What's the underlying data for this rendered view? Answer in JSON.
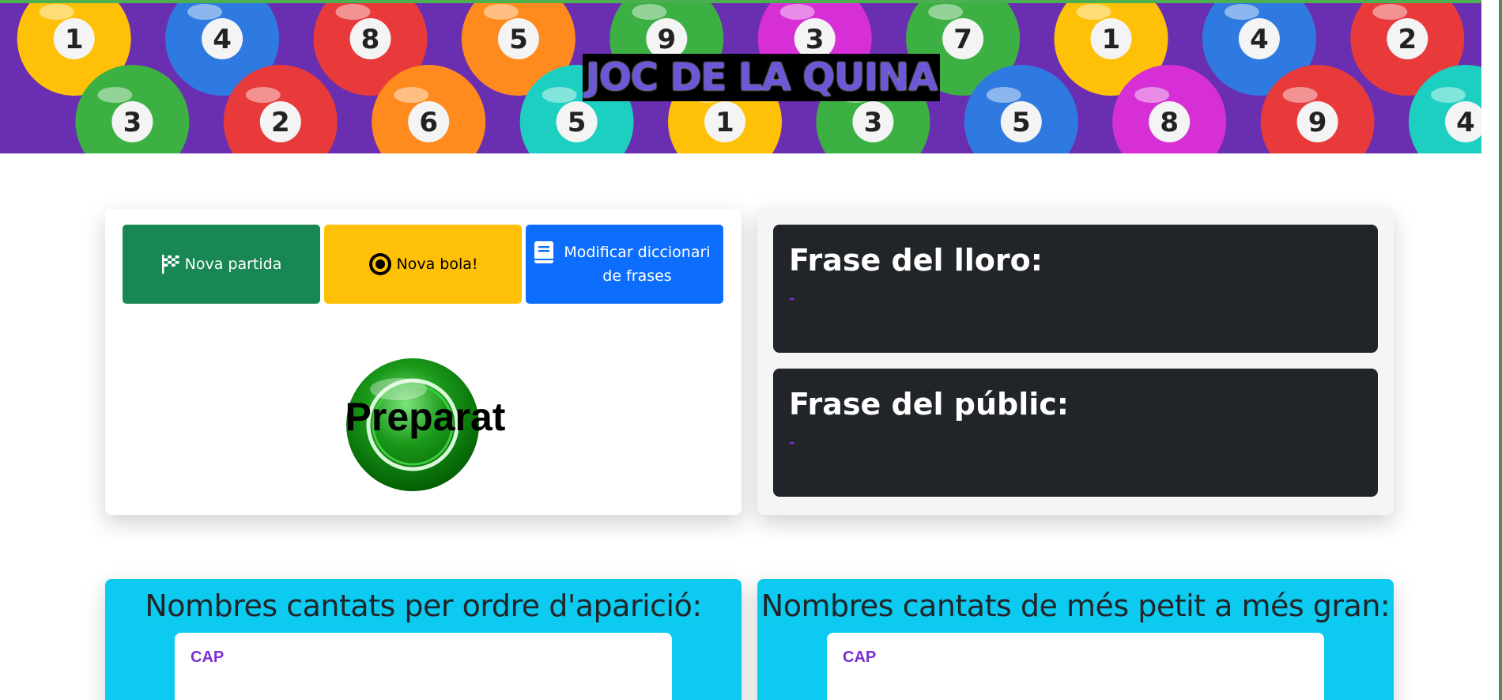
{
  "banner": {
    "title": "JOC DE LA QUINA",
    "balls": [
      {
        "n": "1",
        "c": "#ffc107"
      },
      {
        "n": "4",
        "c": "#2f7ae0"
      },
      {
        "n": "8",
        "c": "#e83a3a"
      },
      {
        "n": "5",
        "c": "#ff8a1e"
      },
      {
        "n": "9",
        "c": "#3cb043"
      },
      {
        "n": "3",
        "c": "#d62fd6"
      },
      {
        "n": "7",
        "c": "#3cb043"
      },
      {
        "n": "1",
        "c": "#ffc107"
      },
      {
        "n": "4",
        "c": "#2f7ae0"
      },
      {
        "n": "2",
        "c": "#e83a3a"
      },
      {
        "n": "3",
        "c": "#3cb043"
      },
      {
        "n": "2",
        "c": "#e83a3a"
      },
      {
        "n": "6",
        "c": "#ff8a1e"
      },
      {
        "n": "5",
        "c": "#1ccfc0"
      },
      {
        "n": "1",
        "c": "#ffc107"
      },
      {
        "n": "3",
        "c": "#3cb043"
      },
      {
        "n": "5",
        "c": "#2f7ae0"
      },
      {
        "n": "8",
        "c": "#d62fd6"
      },
      {
        "n": "9",
        "c": "#e83a3a"
      },
      {
        "n": "4",
        "c": "#1ccfc0"
      }
    ]
  },
  "controls": {
    "new_game": "Nova partida",
    "new_ball": "Nova bola!",
    "edit_dictionary": "Modificar diccionari de frases",
    "ball_status": "Preparat"
  },
  "phrases": {
    "parrot_title": "Frase del lloro:",
    "parrot_value": "-",
    "public_title": "Frase del públic:",
    "public_value": "-"
  },
  "numbers": {
    "by_order_title": "Nombres cantats per ordre d'aparició:",
    "by_order_value": "CAP",
    "sorted_title": "Nombres cantats de més petit a més gran:",
    "sorted_value": "CAP"
  },
  "colors": {
    "green": "#198754",
    "yellow": "#ffc107",
    "blue": "#0d6efd",
    "dark": "#212529",
    "cyan": "#0dcaf0",
    "purple": "#7b2fd1"
  }
}
